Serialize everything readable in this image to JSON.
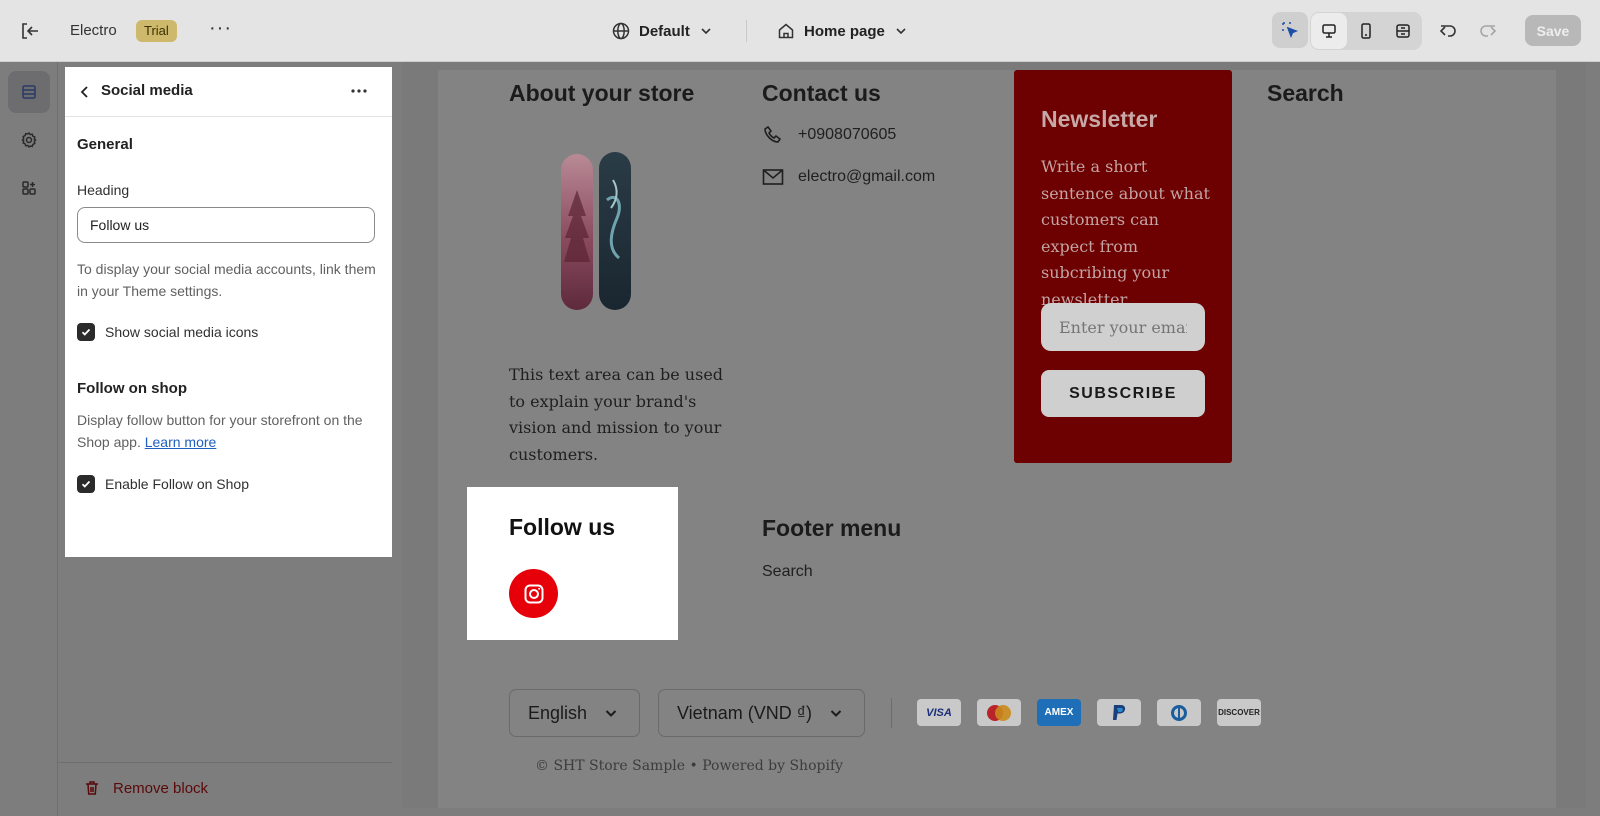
{
  "topbar": {
    "store_name": "Electro",
    "trial_badge": "Trial",
    "theme_label": "Default",
    "page_label": "Home page",
    "save_label": "Save"
  },
  "panel": {
    "title": "Social media",
    "general_title": "General",
    "heading_label": "Heading",
    "heading_value": "Follow us",
    "help_text": "To display your social media accounts, link them in your Theme settings.",
    "show_icons_label": "Show social media icons",
    "follow_shop_title": "Follow on shop",
    "follow_shop_help": "Display follow button for your storefront on the Shop app.",
    "learn_more": "Learn more",
    "enable_follow_label": "Enable Follow on Shop",
    "remove_block": "Remove block"
  },
  "preview": {
    "about_title": "About your store",
    "about_text": "This text area can be used to explain your brand's vision and mission to your customers.",
    "contact_title": "Contact us",
    "phone": "+0908070605",
    "email": "electro@gmail.com",
    "newsletter_title": "Newsletter",
    "newsletter_text": "Write a short sentence about what customers can expect from subcribing your newsletter.",
    "newsletter_placeholder": "Enter your email",
    "subscribe_label": "SUBSCRIBE",
    "search_title": "Search",
    "follow_title": "Follow us",
    "footer_menu_title": "Footer menu",
    "footer_menu_link": "Search",
    "language": "English",
    "country": "Vietnam (VND ₫)",
    "payments": [
      "VISA",
      "Mastercard",
      "AMEX",
      "PayPal",
      "Diners",
      "DISCOVER"
    ],
    "copyright": "© SHT Store Sample • Powered by Shopify"
  }
}
